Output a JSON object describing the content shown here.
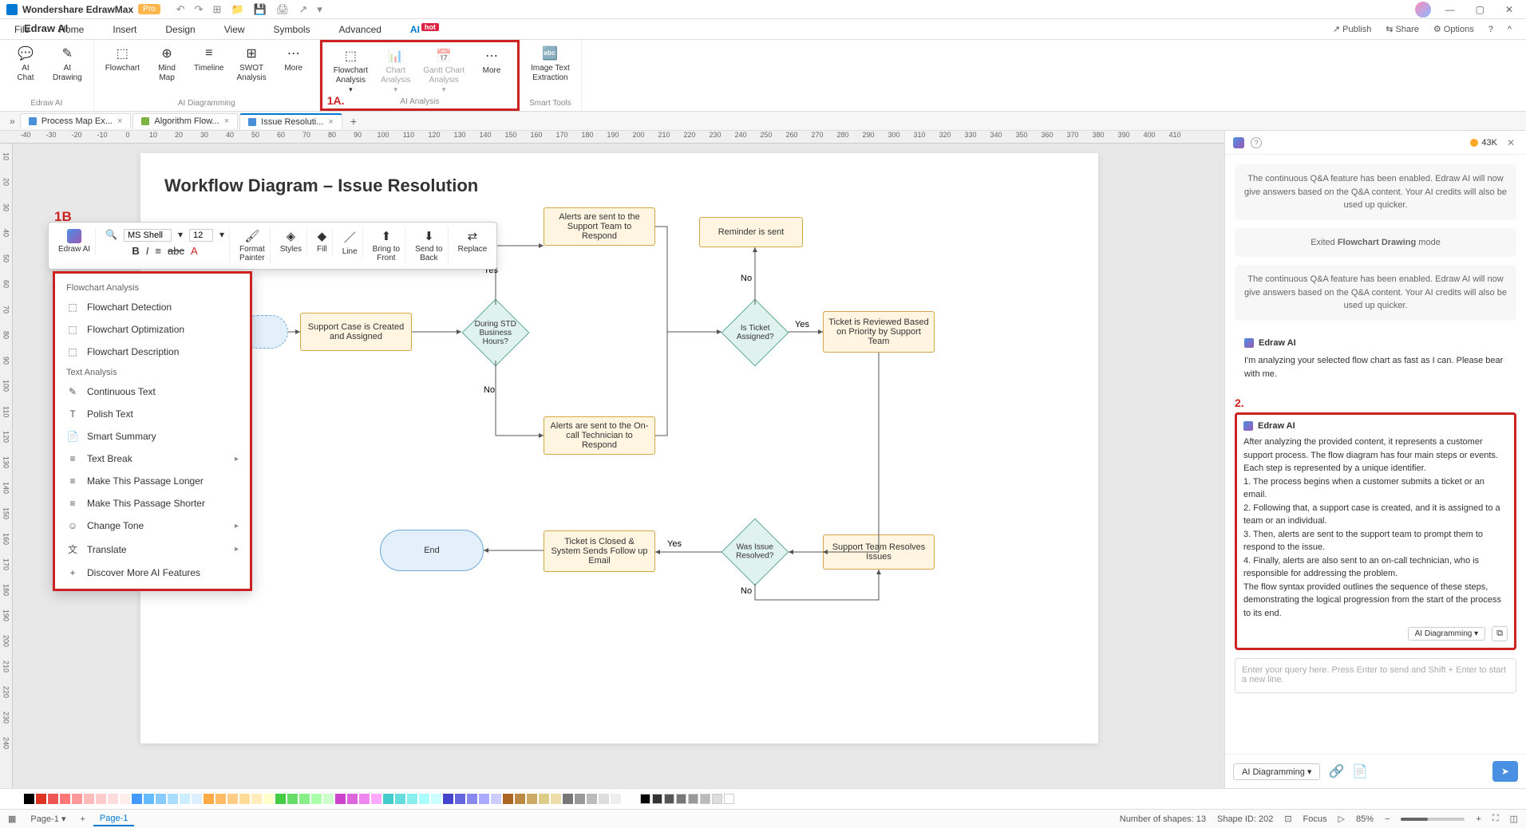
{
  "titlebar": {
    "app": "Wondershare EdrawMax",
    "badge": "Pro"
  },
  "menubar": [
    "File",
    "Home",
    "Insert",
    "Design",
    "View",
    "Symbols",
    "Advanced"
  ],
  "menubar_ai": "AI",
  "menubar_hot": "hot",
  "topright": {
    "publish": "Publish",
    "share": "Share",
    "options": "Options"
  },
  "ribbon": {
    "g1": {
      "label": "Edraw AI",
      "btns": [
        {
          "t": "AI\nChat"
        },
        {
          "t": "AI\nDrawing"
        }
      ]
    },
    "g2": {
      "label": "AI Diagramming",
      "btns": [
        {
          "t": "Flowchart"
        },
        {
          "t": "Mind\nMap"
        },
        {
          "t": "Timeline"
        },
        {
          "t": "SWOT\nAnalysis"
        },
        {
          "t": "More"
        }
      ]
    },
    "g3": {
      "label": "AI Analysis",
      "btns": [
        {
          "t": "Flowchart\nAnalysis"
        },
        {
          "t": "Chart\nAnalysis",
          "dis": true
        },
        {
          "t": "Gantt Chart\nAnalysis",
          "dis": true
        },
        {
          "t": "More"
        }
      ]
    },
    "g4": {
      "label": "Smart Tools",
      "btns": [
        {
          "t": "Image Text\nExtraction"
        }
      ]
    },
    "ann1a": "1A."
  },
  "tabs": [
    {
      "label": "Process Map Ex...",
      "active": false
    },
    {
      "label": "Algorithm Flow...",
      "active": false
    },
    {
      "label": "Issue Resoluti...",
      "active": true
    }
  ],
  "ruler_h": [
    "-40",
    "-30",
    "-20",
    "-10",
    "0",
    "10",
    "20",
    "30",
    "40",
    "50",
    "60",
    "70",
    "80",
    "90",
    "100",
    "110",
    "120",
    "130",
    "140",
    "150",
    "160",
    "170",
    "180",
    "190",
    "200",
    "210",
    "220",
    "230",
    "240",
    "250",
    "260",
    "270",
    "280",
    "290",
    "300",
    "310",
    "320",
    "330",
    "340",
    "350",
    "360",
    "370",
    "380",
    "390",
    "400",
    "410"
  ],
  "ruler_v": [
    "10",
    "20",
    "30",
    "40",
    "50",
    "60",
    "70",
    "80",
    "90",
    "100",
    "110",
    "120",
    "130",
    "140",
    "150",
    "160",
    "170",
    "180",
    "190",
    "200",
    "210",
    "220",
    "230",
    "240"
  ],
  "diagram": {
    "title": "Workflow Diagram – Issue Resolution",
    "ann1b": "1B",
    "shapes": {
      "s1": "Support Case is\nCreated and Assigned",
      "s2": "During STD\nBusiness\nHours?",
      "s3": "Alerts are sent to the\nSupport Team to\nRespond",
      "s4": "Alerts are sent to the\nOn-call Technician to\nRespond",
      "s5": "Is Ticket\nAssigned?",
      "s6": "Reminder is sent",
      "s7": "Ticket is Reviewed\nBased  on Priority by\nSupport Team",
      "s8": "Support Team\nResolves Issues",
      "s9": "Was Issue\nResolved?",
      "s10": "Ticket is Closed &\nSystem Sends Follow\nup Email",
      "s11": "End"
    },
    "labels": {
      "yes": "Yes",
      "no": "No"
    }
  },
  "floatbar": {
    "edraw": "Edraw AI",
    "font": "MS Shell",
    "size": "12",
    "format": "Format\nPainter",
    "styles": "Styles",
    "fill": "Fill",
    "line": "Line",
    "front": "Bring to\nFront",
    "back": "Send to\nBack",
    "replace": "Replace"
  },
  "ctx": {
    "sec1": "Flowchart Analysis",
    "i1": "Flowchart Detection",
    "i2": "Flowchart Optimization",
    "i3": "Flowchart Description",
    "sec2": "Text Analysis",
    "i4": "Continuous Text",
    "i5": "Polish Text",
    "i6": "Smart Summary",
    "i7": "Text Break",
    "i8": "Make This Passage Longer",
    "i9": "Make This Passage Shorter",
    "i10": "Change Tone",
    "i11": "Translate",
    "i12": "Discover More AI Features"
  },
  "ai": {
    "title": "Edraw AI",
    "credits": "43K",
    "sys1": "The continuous Q&A feature has been enabled. Edraw AI will now give answers based on the Q&A content. Your AI credits will also be used up quicker.",
    "tag1_a": "Exited ",
    "tag1_b": "Flowchart Drawing",
    "tag1_c": " mode",
    "sys2": "The continuous Q&A feature has been enabled. Edraw AI will now give answers based on the Q&A content. Your AI credits will also be used up quicker.",
    "name": "Edraw AI",
    "m1": "I'm analyzing your selected flow chart as fast as I can. Please bear with me.",
    "ann2": "2.",
    "m2": "After analyzing the provided content, it represents a customer support process. The flow diagram has four main steps or events. Each step is represented by a unique identifier.\n1. The process begins when a customer submits a ticket or an email.\n2. Following that, a support case is created, and it is assigned to a team or an individual.\n3. Then, alerts are sent to the support team to prompt them to respond to the issue.\n4. Finally, alerts are also sent to an on-call technician, who is responsible for addressing the problem.\nThe flow syntax provided outlines the sequence of these steps, demonstrating the logical progression from the start of the process to its end.",
    "footdd": "AI Diagramming",
    "placeholder": "Enter your query here. Press Enter to send and Shift + Enter to start a new line.",
    "btmdd": "AI Diagramming"
  },
  "palette": [
    "#000",
    "#c22",
    "#e55",
    "#f77",
    "#f99",
    "#fbb",
    "#fcc",
    "#fdd",
    "#4af",
    "#6bf",
    "#8cf",
    "#adf",
    "#cef",
    "#4c8",
    "#6d9",
    "#8ea",
    "#afa",
    "#fa4",
    "#fb6",
    "#fc8",
    "#fd9",
    "#feb",
    "#c4c",
    "#d6d",
    "#e8e",
    "#f9f",
    "#4cc",
    "#6dd",
    "#8ee",
    "#9ff"
  ],
  "status": {
    "page": "Page-1",
    "page2": "Page-1",
    "shapes": "Number of shapes: 13",
    "shapeid": "Shape ID: 202",
    "focus": "Focus",
    "zoom": "85%"
  }
}
